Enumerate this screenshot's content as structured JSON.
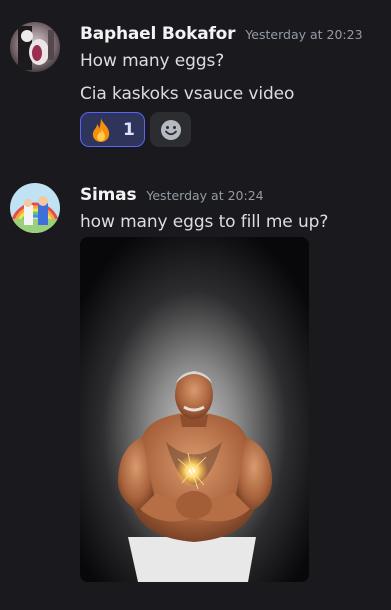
{
  "messages": [
    {
      "author": "Baphael Bokafor",
      "timestamp": "Yesterday at 20:23",
      "lines": [
        "How many eggs?",
        "Cia kaskoks vsauce video"
      ],
      "reactions": [
        {
          "emoji": "fire-emoji",
          "count": "1",
          "active": true
        }
      ]
    },
    {
      "author": "Simas",
      "timestamp": "Yesterday at 20:24",
      "lines": [
        "how many eggs to fill me up?"
      ],
      "attachment": {
        "type": "image"
      }
    }
  ],
  "icons": {
    "add_reaction": "smiley-face-icon",
    "reaction": "fire-emoji"
  },
  "colors": {
    "background": "#1a1a1e",
    "author": "#f2f3f5",
    "text": "#dbdee1",
    "timestamp": "#949ba4",
    "reaction_active_bg": "#2f345b",
    "reaction_active_border": "#5865f2",
    "reaction_add_bg": "#2b2d31"
  }
}
